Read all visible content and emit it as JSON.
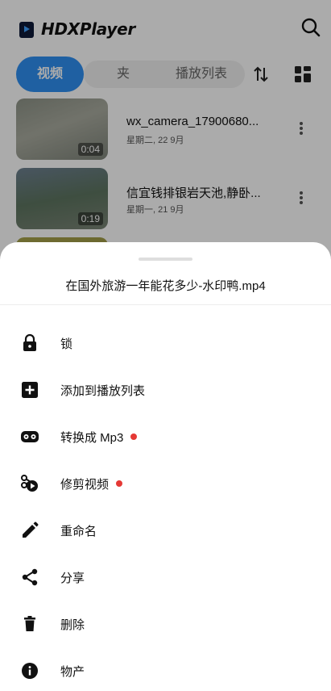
{
  "app": {
    "brand": "HDXPlayer",
    "tabs": [
      {
        "label": "视频",
        "active": true
      },
      {
        "label": "夹",
        "active": false
      },
      {
        "label": "播放列表",
        "active": false
      }
    ],
    "videos": [
      {
        "title": "wx_camera_17900680...",
        "date": "星期二, 22 9月",
        "duration": "0:04"
      },
      {
        "title": "信宜钱排银岩天池,静卧...",
        "date": "星期一, 21 9月",
        "duration": "0:19"
      }
    ]
  },
  "sheet": {
    "title": "在国外旅游一年能花多少-水印鸭.mp4",
    "items": [
      {
        "label": "锁",
        "icon": "lock-icon",
        "badge": false
      },
      {
        "label": "添加到播放列表",
        "icon": "add-box-icon",
        "badge": false
      },
      {
        "label": "转换成 Mp3",
        "icon": "cassette-icon",
        "badge": true
      },
      {
        "label": "修剪视频",
        "icon": "scissors-icon",
        "badge": true
      },
      {
        "label": "重命名",
        "icon": "pencil-icon",
        "badge": false
      },
      {
        "label": "分享",
        "icon": "share-icon",
        "badge": false
      },
      {
        "label": "删除",
        "icon": "trash-icon",
        "badge": false
      },
      {
        "label": "物产",
        "icon": "info-icon",
        "badge": false
      }
    ]
  },
  "colors": {
    "accent": "#2f8ff2",
    "badge": "#e53935",
    "scrim": "rgba(0,0,0,0.33)"
  }
}
